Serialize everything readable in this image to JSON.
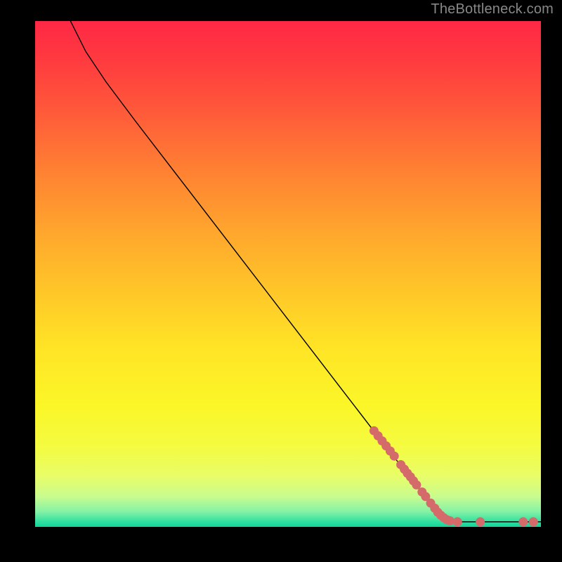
{
  "watermark": "TheBottleneck.com",
  "chart_data": {
    "type": "line",
    "title": "",
    "xlabel": "",
    "ylabel": "",
    "xlim": [
      0,
      100
    ],
    "ylim": [
      0,
      100
    ],
    "grid": false,
    "curve": [
      {
        "x": 7,
        "y": 100
      },
      {
        "x": 10,
        "y": 94
      },
      {
        "x": 14,
        "y": 88
      },
      {
        "x": 20,
        "y": 80
      },
      {
        "x": 30,
        "y": 67
      },
      {
        "x": 40,
        "y": 54
      },
      {
        "x": 50,
        "y": 41
      },
      {
        "x": 60,
        "y": 28
      },
      {
        "x": 70,
        "y": 15
      },
      {
        "x": 78,
        "y": 5
      },
      {
        "x": 82,
        "y": 1.5
      },
      {
        "x": 84,
        "y": 1
      },
      {
        "x": 100,
        "y": 1
      }
    ],
    "markers": [
      {
        "x": 67,
        "y": 19
      },
      {
        "x": 67.8,
        "y": 18
      },
      {
        "x": 68.6,
        "y": 17
      },
      {
        "x": 69.4,
        "y": 16
      },
      {
        "x": 70.2,
        "y": 15
      },
      {
        "x": 71,
        "y": 14
      },
      {
        "x": 72.3,
        "y": 12.3
      },
      {
        "x": 73,
        "y": 11.4
      },
      {
        "x": 73.6,
        "y": 10.6
      },
      {
        "x": 74.2,
        "y": 9.9
      },
      {
        "x": 74.8,
        "y": 9.1
      },
      {
        "x": 75.4,
        "y": 8.3
      },
      {
        "x": 76.5,
        "y": 6.9
      },
      {
        "x": 77.2,
        "y": 6
      },
      {
        "x": 78.2,
        "y": 4.7
      },
      {
        "x": 79,
        "y": 3.7
      },
      {
        "x": 79.6,
        "y": 2.9
      },
      {
        "x": 80.2,
        "y": 2.3
      },
      {
        "x": 80.8,
        "y": 1.8
      },
      {
        "x": 81.4,
        "y": 1.4
      },
      {
        "x": 82,
        "y": 1.2
      },
      {
        "x": 83.5,
        "y": 1
      },
      {
        "x": 88,
        "y": 1
      },
      {
        "x": 96.5,
        "y": 1
      },
      {
        "x": 98.5,
        "y": 1
      }
    ]
  },
  "colors": {
    "marker": "#d46a6a",
    "curve": "#000000",
    "background_frame": "#000000"
  }
}
